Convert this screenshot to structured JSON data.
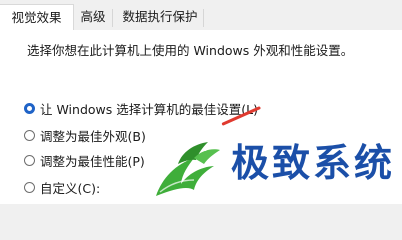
{
  "tabs": [
    {
      "label": "视觉效果",
      "selected": true
    },
    {
      "label": "高级",
      "selected": false
    },
    {
      "label": "数据执行保护",
      "selected": false
    }
  ],
  "panel": {
    "description": "选择你想在此计算机上使用的 Windows 外观和性能设置。"
  },
  "options": [
    {
      "label": "让 Windows 选择计算机的最佳设置(L)",
      "checked": true
    },
    {
      "label": "调整为最佳外观(B)",
      "checked": false
    },
    {
      "label": "调整为最佳性能(P)",
      "checked": false
    },
    {
      "label": "自定义(C):",
      "checked": false
    }
  ],
  "watermark": {
    "text": "极致系统",
    "icon": "dragon-logo-icon"
  },
  "colors": {
    "accent": "#1f63c7",
    "watermark_text": "#1b4fa8",
    "logo_green": "#3fae3a",
    "annotation_red": "#e03a2f"
  }
}
